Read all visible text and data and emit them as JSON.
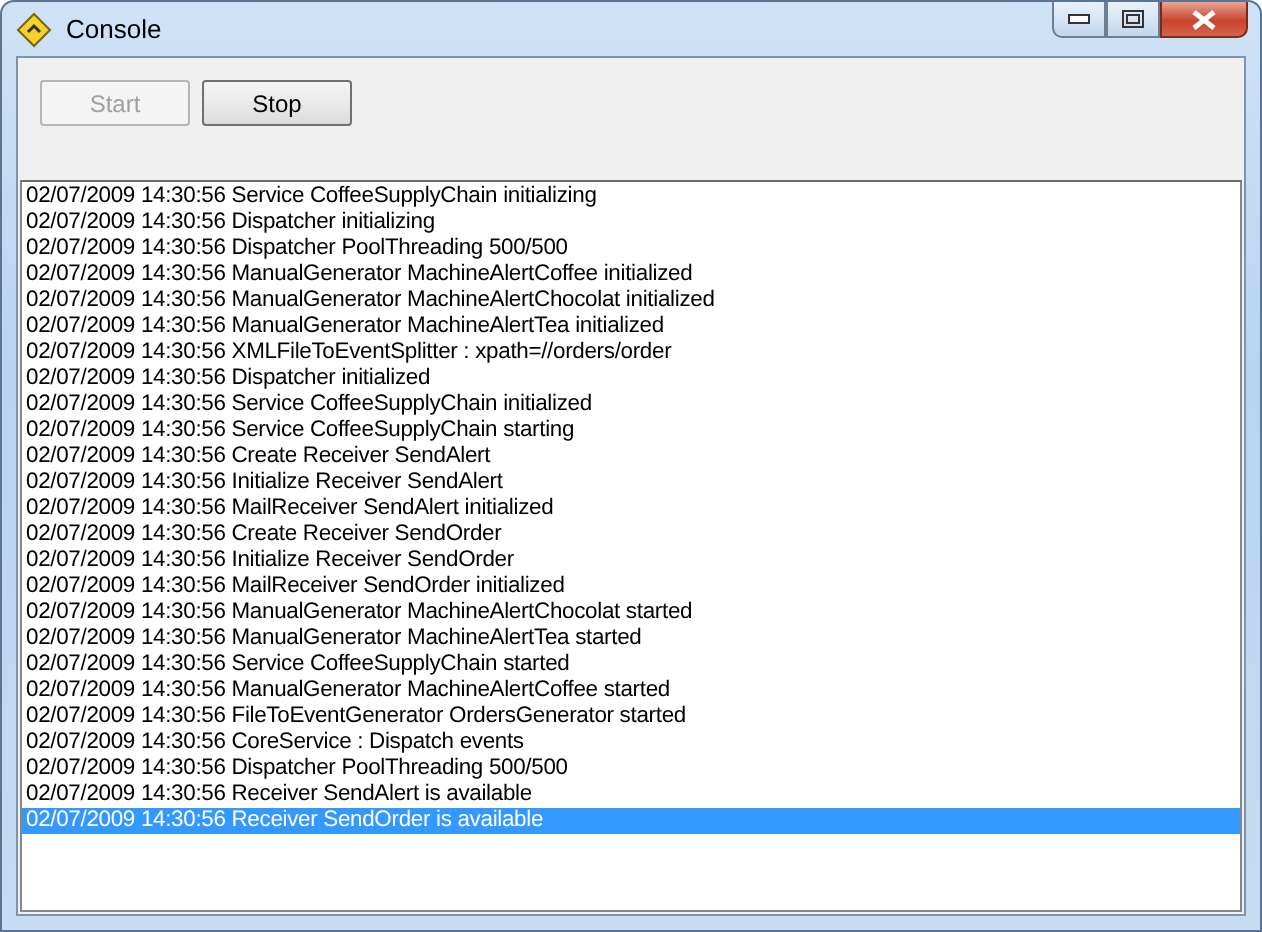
{
  "window": {
    "title": "Console"
  },
  "buttons": [
    {
      "label": "Start",
      "disabled": true
    },
    {
      "label": "Stop",
      "disabled": false
    }
  ],
  "log": [
    {
      "text": "02/07/2009 14:30:56 Service CoffeeSupplyChain initializing",
      "selected": false
    },
    {
      "text": "02/07/2009 14:30:56 Dispatcher initializing",
      "selected": false
    },
    {
      "text": "02/07/2009 14:30:56 Dispatcher PoolThreading 500/500",
      "selected": false
    },
    {
      "text": "02/07/2009 14:30:56 ManualGenerator MachineAlertCoffee initialized",
      "selected": false
    },
    {
      "text": "02/07/2009 14:30:56 ManualGenerator MachineAlertChocolat initialized",
      "selected": false
    },
    {
      "text": "02/07/2009 14:30:56 ManualGenerator MachineAlertTea initialized",
      "selected": false
    },
    {
      "text": "02/07/2009 14:30:56 XMLFileToEventSplitter : xpath=//orders/order",
      "selected": false
    },
    {
      "text": "02/07/2009 14:30:56 Dispatcher initialized",
      "selected": false
    },
    {
      "text": "02/07/2009 14:30:56 Service CoffeeSupplyChain initialized",
      "selected": false
    },
    {
      "text": "02/07/2009 14:30:56 Service CoffeeSupplyChain starting",
      "selected": false
    },
    {
      "text": "02/07/2009 14:30:56 Create Receiver SendAlert",
      "selected": false
    },
    {
      "text": "02/07/2009 14:30:56 Initialize Receiver SendAlert",
      "selected": false
    },
    {
      "text": "02/07/2009 14:30:56 MailReceiver SendAlert initialized",
      "selected": false
    },
    {
      "text": "02/07/2009 14:30:56 Create Receiver SendOrder",
      "selected": false
    },
    {
      "text": "02/07/2009 14:30:56 Initialize Receiver SendOrder",
      "selected": false
    },
    {
      "text": "02/07/2009 14:30:56 MailReceiver SendOrder initialized",
      "selected": false
    },
    {
      "text": "02/07/2009 14:30:56 ManualGenerator MachineAlertChocolat started",
      "selected": false
    },
    {
      "text": "02/07/2009 14:30:56 ManualGenerator MachineAlertTea started",
      "selected": false
    },
    {
      "text": "02/07/2009 14:30:56 Service CoffeeSupplyChain started",
      "selected": false
    },
    {
      "text": "02/07/2009 14:30:56 ManualGenerator MachineAlertCoffee started",
      "selected": false
    },
    {
      "text": "02/07/2009 14:30:56 FileToEventGenerator OrdersGenerator started",
      "selected": false
    },
    {
      "text": "02/07/2009 14:30:56 CoreService : Dispatch events",
      "selected": false
    },
    {
      "text": "02/07/2009 14:30:56 Dispatcher PoolThreading 500/500",
      "selected": false
    },
    {
      "text": "02/07/2009 14:30:56 Receiver SendAlert is available",
      "selected": false
    },
    {
      "text": "02/07/2009 14:30:56 Receiver SendOrder is available",
      "selected": true
    }
  ]
}
